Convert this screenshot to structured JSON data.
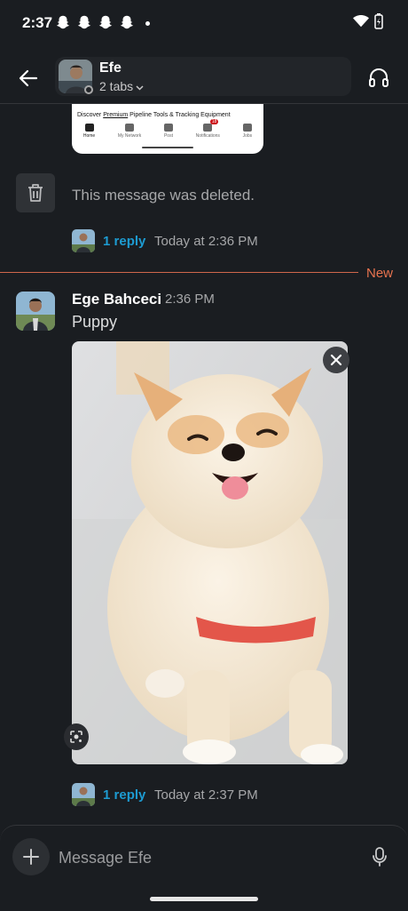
{
  "status_bar": {
    "time": "2:37"
  },
  "header": {
    "name": "Efe",
    "tabs_label": "2 tabs"
  },
  "link_preview": {
    "headline_start": "Discover ",
    "headline_link": "Premium",
    "headline_end": " Pipeline Tools & Tracking Equipment",
    "tabs": [
      {
        "label": "Home"
      },
      {
        "label": "My Network"
      },
      {
        "label": "Post"
      },
      {
        "label": "Notifications",
        "badge": "18"
      },
      {
        "label": "Jobs"
      }
    ]
  },
  "deleted_message": {
    "text": "This message was deleted.",
    "replies": "1 reply",
    "reply_time": "Today at 2:36 PM"
  },
  "divider": {
    "label": "New"
  },
  "message": {
    "author": "Ege Bahceci",
    "time": "2:36 PM",
    "text": "Puppy",
    "replies": "1 reply",
    "reply_time": "Today at 2:37 PM"
  },
  "composer": {
    "placeholder": "Message Efe"
  },
  "colors": {
    "accent_link": "#1d9bd1",
    "new_divider": "#e8734f",
    "background": "#1a1d21"
  }
}
